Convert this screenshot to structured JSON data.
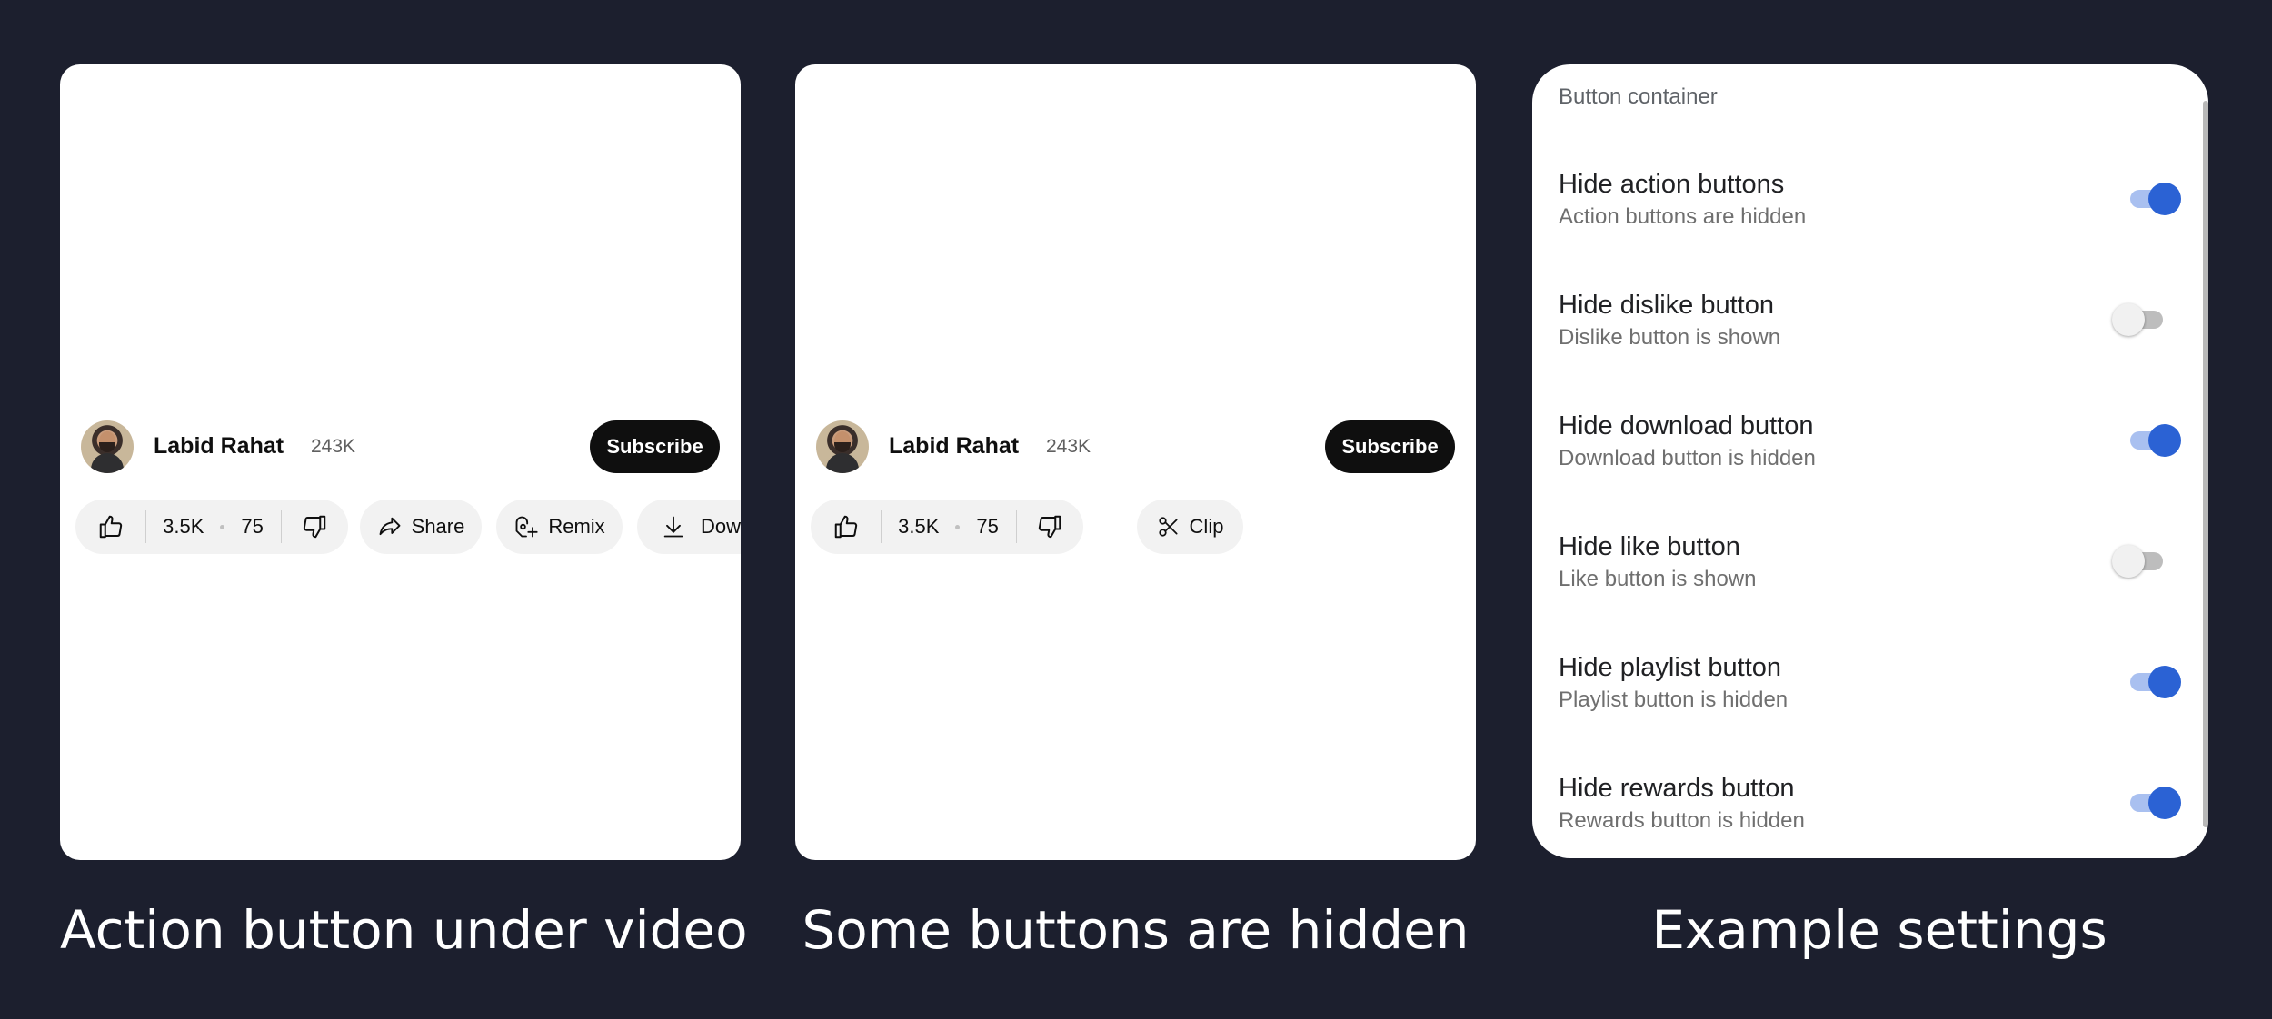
{
  "channel": {
    "name": "Labid Rahat",
    "subscribers": "243K",
    "subscribe_label": "Subscribe"
  },
  "actions": {
    "like_count": "3.5K",
    "dislike_count": "75",
    "share_label": "Share",
    "remix_label": "Remix",
    "download_label": "Down",
    "clip_label": "Clip"
  },
  "settings": {
    "header": "Button container",
    "items": [
      {
        "title": "Hide action buttons",
        "subtitle": "Action buttons are hidden",
        "enabled": true
      },
      {
        "title": "Hide dislike button",
        "subtitle": "Dislike button is shown",
        "enabled": false
      },
      {
        "title": "Hide download button",
        "subtitle": "Download button is hidden",
        "enabled": true
      },
      {
        "title": "Hide like button",
        "subtitle": "Like button is shown",
        "enabled": false
      },
      {
        "title": "Hide playlist button",
        "subtitle": "Playlist button is hidden",
        "enabled": true
      },
      {
        "title": "Hide rewards button",
        "subtitle": "Rewards button is hidden",
        "enabled": true
      }
    ]
  },
  "captions": {
    "left": "Action button under video",
    "middle": "Some buttons are hidden",
    "right": "Example settings"
  },
  "colors": {
    "background": "#1c1f2e",
    "toggle_on": "#2b62d4",
    "subscribe_bg": "#0f0f0f"
  },
  "icons": [
    "thumbs-up-icon",
    "thumbs-down-icon",
    "share-icon",
    "remix-icon",
    "download-icon",
    "scissors-icon"
  ]
}
